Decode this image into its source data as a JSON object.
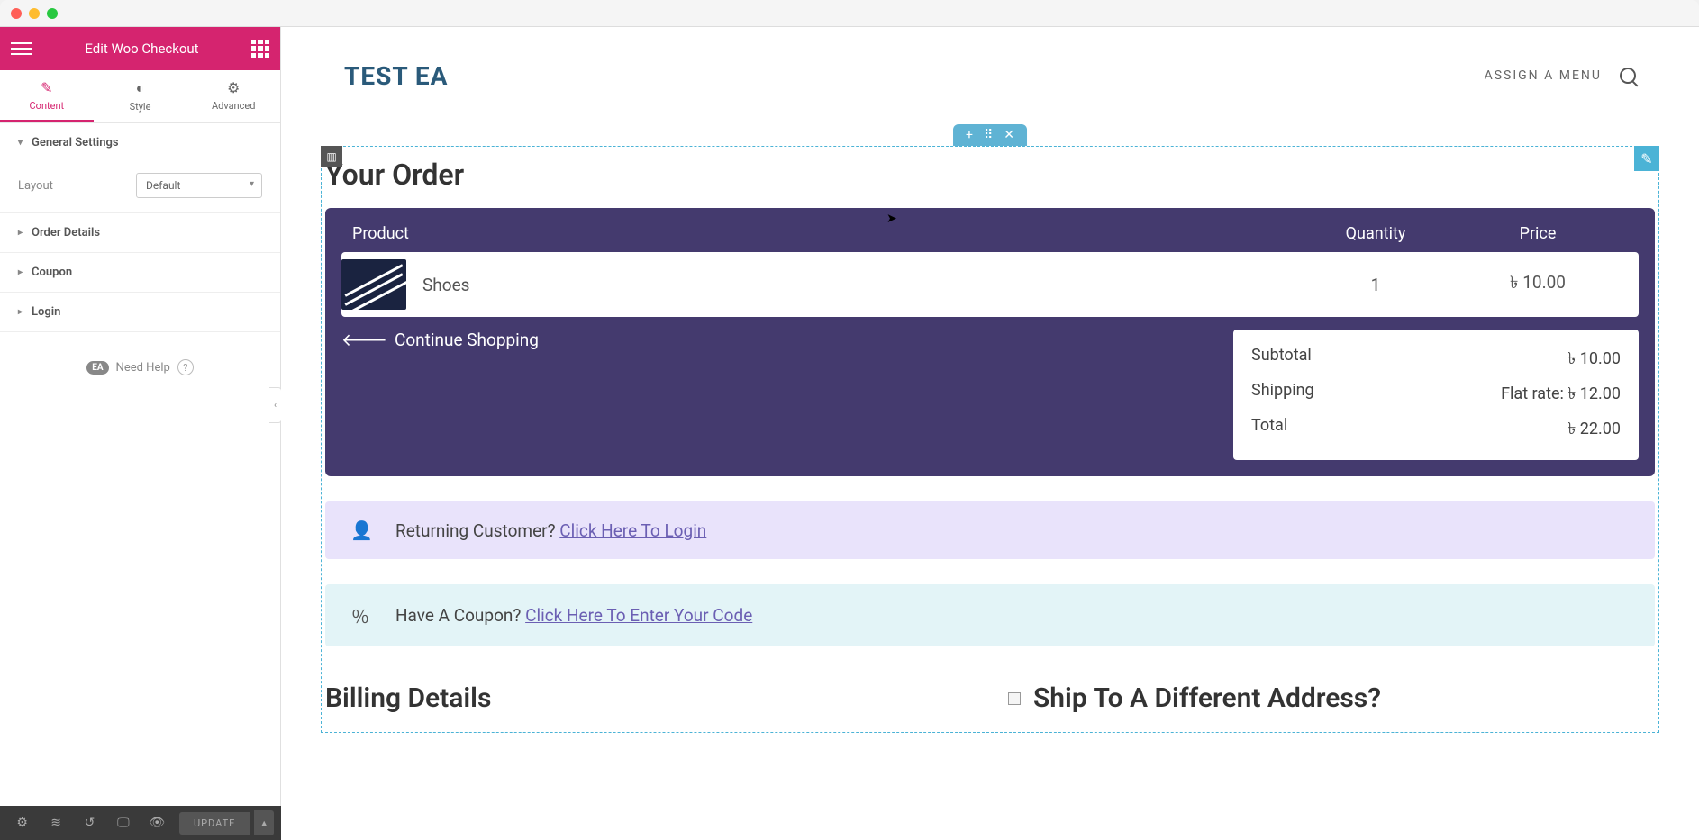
{
  "sidebar": {
    "title": "Edit Woo Checkout",
    "tabs": {
      "content": "Content",
      "style": "Style",
      "advanced": "Advanced"
    },
    "sections": {
      "general": "General Settings",
      "layout_label": "Layout",
      "layout_value": "Default",
      "order_details": "Order Details",
      "coupon": "Coupon",
      "login": "Login"
    },
    "help": {
      "badge": "EA",
      "text": "Need Help",
      "q": "?"
    }
  },
  "footer": {
    "update": "UPDATE"
  },
  "topbar": {
    "site": "TEST EA",
    "menu": "ASSIGN A MENU"
  },
  "order": {
    "title": "Your Order",
    "head": {
      "product": "Product",
      "quantity": "Quantity",
      "price": "Price"
    },
    "item": {
      "name": "Shoes",
      "qty": "1",
      "price": "৳ 10.00"
    },
    "continue": "Continue Shopping",
    "totals": {
      "subtotal_label": "Subtotal",
      "subtotal": "৳ 10.00",
      "shipping_label": "Shipping",
      "shipping": "Flat rate: ৳ 12.00",
      "total_label": "Total",
      "total": "৳ 22.00"
    }
  },
  "login": {
    "text": "Returning Customer? ",
    "link": "Click Here To Login"
  },
  "coupon": {
    "text": "Have A Coupon? ",
    "link": "Click Here To Enter Your Code"
  },
  "billing": {
    "title": "Billing Details"
  },
  "shipping": {
    "title": "Ship To A Different Address?"
  }
}
